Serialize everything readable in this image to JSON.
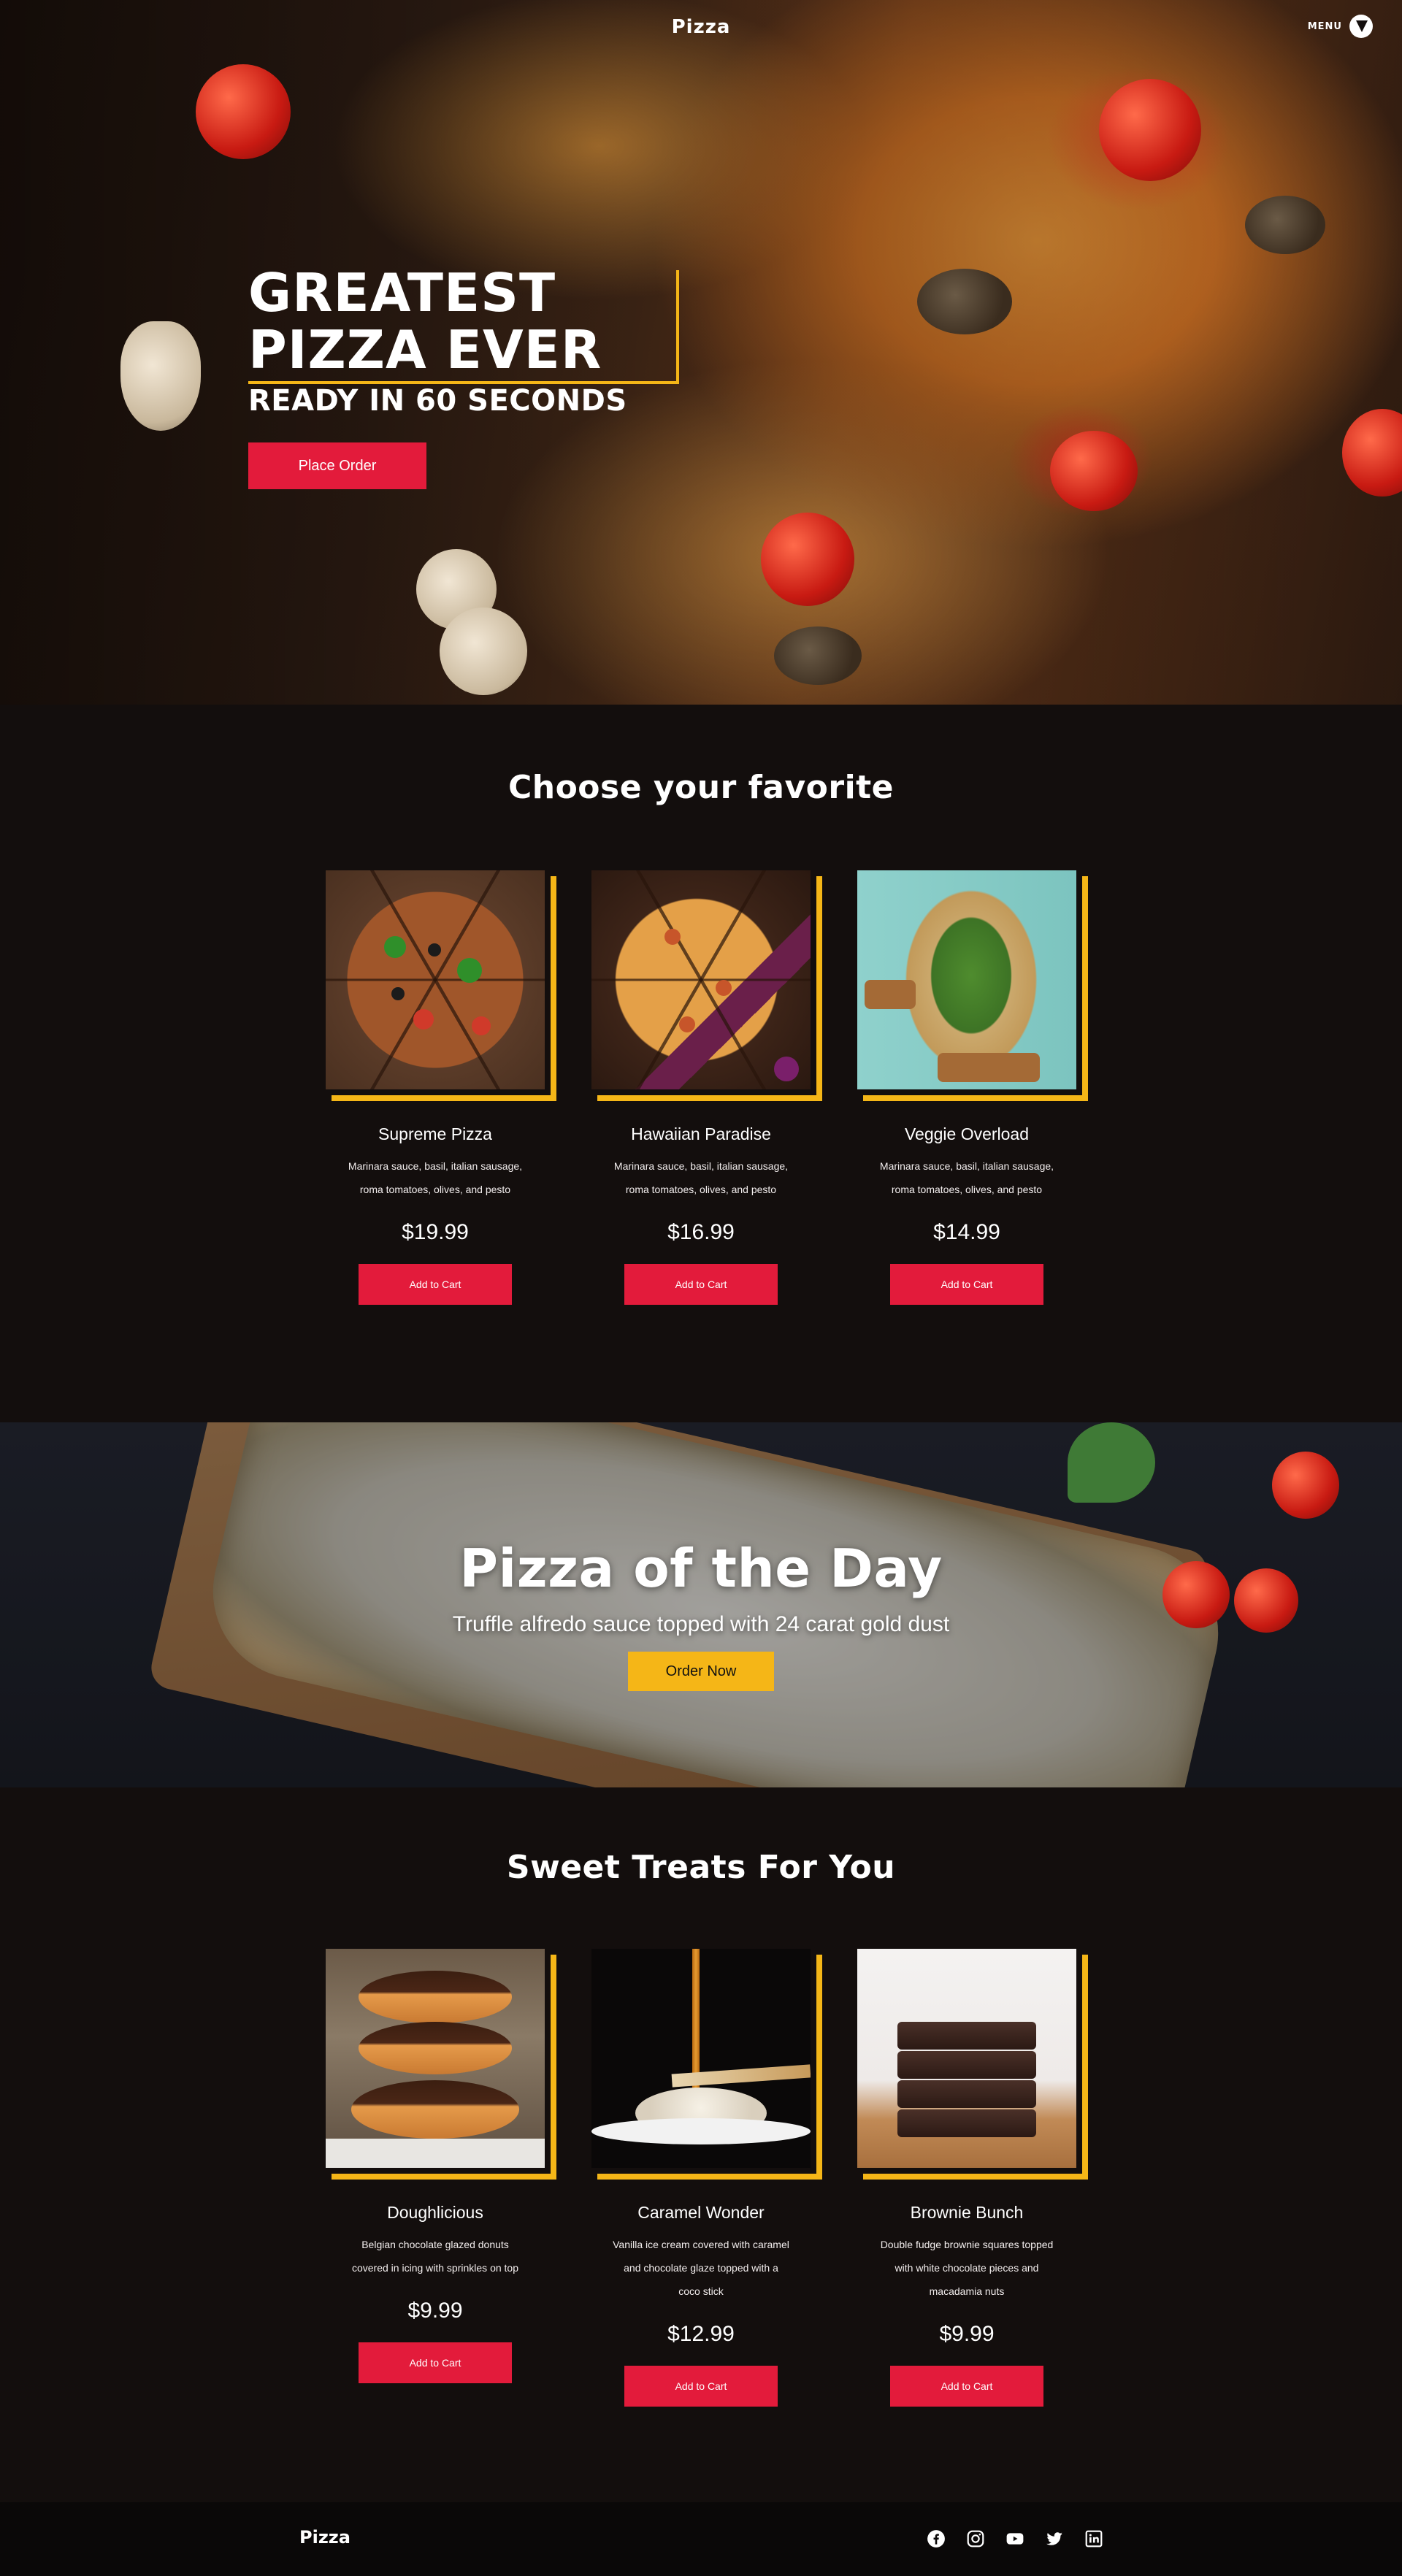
{
  "header": {
    "logo": "Pizza",
    "menu_label": "MENU"
  },
  "hero": {
    "title": "GREATEST\nPIZZA EVER",
    "subtitle": "READY IN 60 SECONDS",
    "cta": "Place Order"
  },
  "favorites": {
    "title": "Choose your favorite",
    "items": [
      {
        "name": "Supreme Pizza",
        "description": "Marinara sauce, basil, italian sausage, roma tomatoes, olives, and pesto",
        "price": "$19.99",
        "button": "Add to Cart"
      },
      {
        "name": "Hawaiian Paradise",
        "description": "Marinara sauce, basil, italian sausage, roma tomatoes, olives, and pesto",
        "price": "$16.99",
        "button": "Add to Cart"
      },
      {
        "name": "Veggie Overload",
        "description": "Marinara sauce, basil, italian sausage, roma tomatoes, olives, and pesto",
        "price": "$14.99",
        "button": "Add to Cart"
      }
    ]
  },
  "pizza_of_the_day": {
    "title": "Pizza of the Day",
    "subtitle": "Truffle alfredo sauce topped with 24 carat gold dust",
    "cta": "Order Now"
  },
  "treats": {
    "title": "Sweet Treats For You",
    "items": [
      {
        "name": "Doughlicious",
        "description": "Belgian chocolate glazed donuts covered in icing with sprinkles on top",
        "price": "$9.99",
        "button": "Add to Cart"
      },
      {
        "name": "Caramel Wonder",
        "description": "Vanilla ice cream covered with caramel and chocolate glaze topped with a coco stick",
        "price": "$12.99",
        "button": "Add to Cart"
      },
      {
        "name": "Brownie Bunch",
        "description": "Double fudge brownie squares topped with white chocolate pieces and macadamia nuts",
        "price": "$9.99",
        "button": "Add to Cart"
      }
    ]
  },
  "footer": {
    "logo": "Pizza",
    "socials": [
      "facebook-icon",
      "instagram-icon",
      "youtube-icon",
      "twitter-icon",
      "linkedin-icon"
    ]
  },
  "colors": {
    "background": "#130e0d",
    "accent_red": "#e31b3b",
    "accent_yellow": "#f5b617",
    "footer": "#0a0808"
  }
}
